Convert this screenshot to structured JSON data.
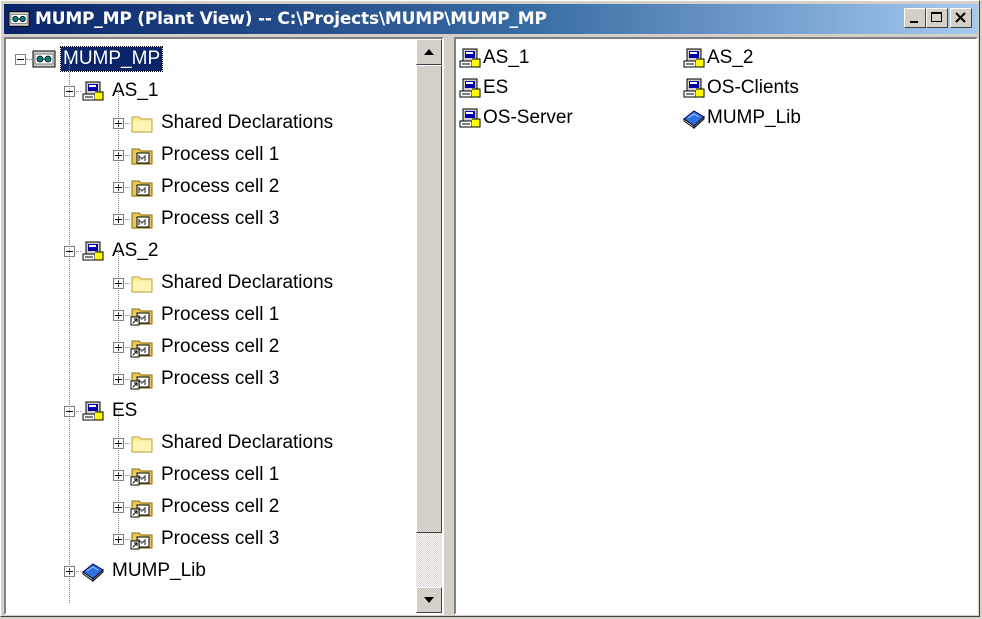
{
  "window": {
    "title": "MUMP_MP (Plant View) -- C:\\Projects\\MUMP\\MUMP_MP",
    "buttons": [
      "minimize",
      "maximize",
      "close"
    ]
  },
  "tree": {
    "root": "MUMP_MP",
    "stations": [
      {
        "label": "AS_1",
        "children": [
          "Shared Declarations",
          "Process cell 1",
          "Process cell 2",
          "Process cell 3"
        ]
      },
      {
        "label": "AS_2",
        "children": [
          "Shared Declarations",
          "Process cell 1",
          "Process cell 2",
          "Process cell 3"
        ]
      },
      {
        "label": "ES",
        "children": [
          "Shared Declarations",
          "Process cell 1",
          "Process cell 2",
          "Process cell 3"
        ]
      }
    ],
    "library": "MUMP_Lib"
  },
  "list": {
    "items": [
      {
        "label": "AS_1",
        "icon": "station-icon"
      },
      {
        "label": "AS_2",
        "icon": "station-icon"
      },
      {
        "label": "ES",
        "icon": "station-icon"
      },
      {
        "label": "OS-Clients",
        "icon": "station-icon"
      },
      {
        "label": "OS-Server",
        "icon": "station-icon"
      },
      {
        "label": "MUMP_Lib",
        "icon": "library-book-icon"
      }
    ]
  }
}
